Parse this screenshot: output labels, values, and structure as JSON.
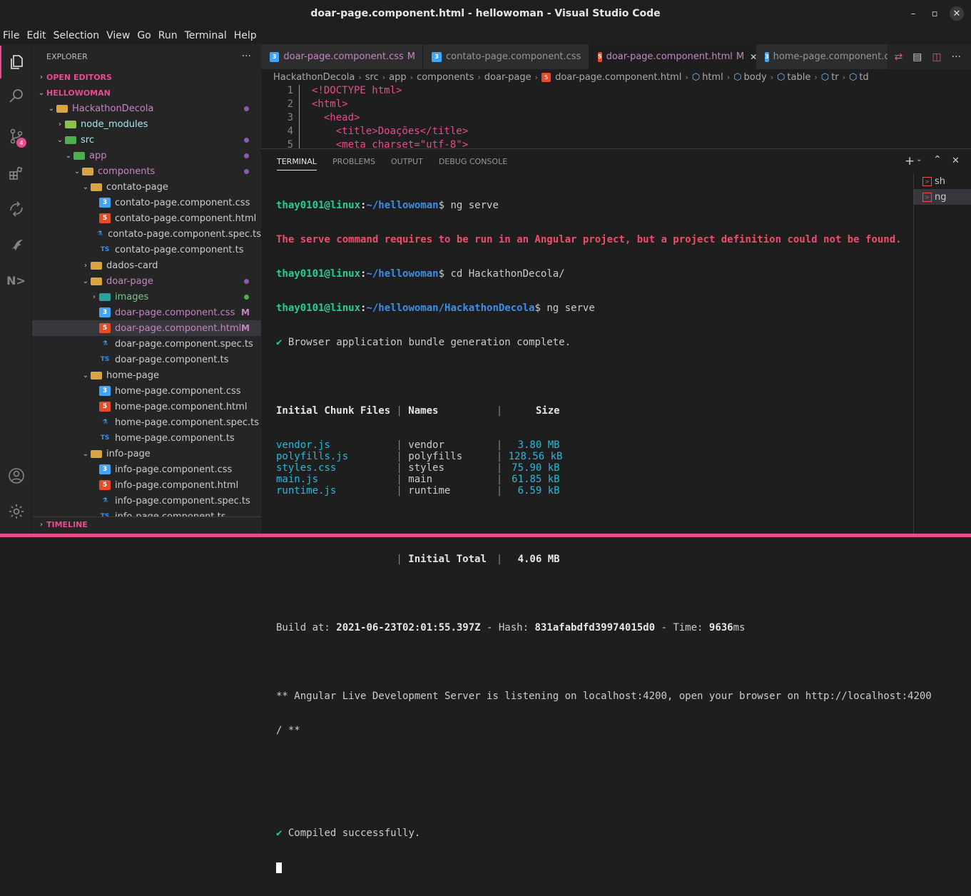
{
  "window": {
    "title": "doar-page.component.html - hellowoman - Visual Studio Code"
  },
  "menu": [
    "File",
    "Edit",
    "Selection",
    "View",
    "Go",
    "Run",
    "Terminal",
    "Help"
  ],
  "activity": {
    "scm_badge": "4"
  },
  "explorer": {
    "title": "EXPLORER",
    "open_editors": "OPEN EDITORS",
    "root": "HELLOWOMAN",
    "timeline": "TIMELINE",
    "tree": [
      {
        "label": "HackathonDecola",
        "depth": 1,
        "type": "folder",
        "open": true,
        "color": "#c586c0",
        "mark": "dot"
      },
      {
        "label": "node_modules",
        "depth": 2,
        "type": "node",
        "open": false,
        "color": "#a5e8f0",
        "mark": ""
      },
      {
        "label": "src",
        "depth": 2,
        "type": "src",
        "open": true,
        "color": "#a5e8f0",
        "mark": "dot"
      },
      {
        "label": "app",
        "depth": 3,
        "type": "app",
        "open": true,
        "color": "#c586c0",
        "mark": "dot"
      },
      {
        "label": "components",
        "depth": 4,
        "type": "folder",
        "open": true,
        "color": "#c586c0",
        "mark": "dot"
      },
      {
        "label": "contato-page",
        "depth": 5,
        "type": "folder",
        "open": true,
        "color": "#cccccc",
        "mark": ""
      },
      {
        "label": "contato-page.component.css",
        "depth": 6,
        "type": "css",
        "color": "#cccccc",
        "mark": ""
      },
      {
        "label": "contato-page.component.html",
        "depth": 6,
        "type": "html",
        "color": "#cccccc",
        "mark": ""
      },
      {
        "label": "contato-page.component.spec.ts",
        "depth": 6,
        "type": "spec",
        "color": "#cccccc",
        "mark": ""
      },
      {
        "label": "contato-page.component.ts",
        "depth": 6,
        "type": "ts",
        "color": "#cccccc",
        "mark": ""
      },
      {
        "label": "dados-card",
        "depth": 5,
        "type": "folder",
        "open": false,
        "color": "#cccccc",
        "mark": ""
      },
      {
        "label": "doar-page",
        "depth": 5,
        "type": "folder",
        "open": true,
        "color": "#c586c0",
        "mark": "dot"
      },
      {
        "label": "images",
        "depth": 6,
        "type": "images",
        "open": false,
        "color": "#73c991",
        "mark": "gdot"
      },
      {
        "label": "doar-page.component.css",
        "depth": 6,
        "type": "css",
        "color": "#c586c0",
        "mark": "M"
      },
      {
        "label": "doar-page.component.html",
        "depth": 6,
        "type": "html",
        "color": "#c586c0",
        "mark": "M",
        "selected": true
      },
      {
        "label": "doar-page.component.spec.ts",
        "depth": 6,
        "type": "spec",
        "color": "#cccccc",
        "mark": ""
      },
      {
        "label": "doar-page.component.ts",
        "depth": 6,
        "type": "ts",
        "color": "#cccccc",
        "mark": ""
      },
      {
        "label": "home-page",
        "depth": 5,
        "type": "folder",
        "open": true,
        "color": "#cccccc",
        "mark": ""
      },
      {
        "label": "home-page.component.css",
        "depth": 6,
        "type": "css",
        "color": "#cccccc",
        "mark": ""
      },
      {
        "label": "home-page.component.html",
        "depth": 6,
        "type": "html",
        "color": "#cccccc",
        "mark": ""
      },
      {
        "label": "home-page.component.spec.ts",
        "depth": 6,
        "type": "spec",
        "color": "#cccccc",
        "mark": ""
      },
      {
        "label": "home-page.component.ts",
        "depth": 6,
        "type": "ts",
        "color": "#cccccc",
        "mark": ""
      },
      {
        "label": "info-page",
        "depth": 5,
        "type": "folder",
        "open": true,
        "color": "#cccccc",
        "mark": ""
      },
      {
        "label": "info-page.component.css",
        "depth": 6,
        "type": "css",
        "color": "#cccccc",
        "mark": ""
      },
      {
        "label": "info-page.component.html",
        "depth": 6,
        "type": "html",
        "color": "#cccccc",
        "mark": ""
      },
      {
        "label": "info-page.component.spec.ts",
        "depth": 6,
        "type": "spec",
        "color": "#cccccc",
        "mark": ""
      },
      {
        "label": "info-page.component.ts",
        "depth": 6,
        "type": "ts",
        "color": "#cccccc",
        "mark": ""
      }
    ]
  },
  "tabs": [
    {
      "label": "doar-page.component.css",
      "type": "css",
      "status": "M",
      "active": false
    },
    {
      "label": "contato-page.component.css",
      "type": "css",
      "status": "",
      "active": false
    },
    {
      "label": "doar-page.component.html",
      "type": "html",
      "status": "M",
      "active": true
    },
    {
      "label": "home-page.component.cs",
      "type": "css",
      "status": "",
      "active": false
    }
  ],
  "breadcrumb": [
    "HackathonDecola",
    "src",
    "app",
    "components",
    "doar-page",
    "doar-page.component.html",
    "html",
    "body",
    "table",
    "tr",
    "td"
  ],
  "editor": {
    "lines": [
      {
        "n": "1",
        "text": "<!DOCTYPE html>"
      },
      {
        "n": "2",
        "text": "<html>"
      },
      {
        "n": "3",
        "text": "  <head>"
      },
      {
        "n": "4",
        "text": "    <title>Doações</title>"
      },
      {
        "n": "5",
        "text": "    <meta charset=\"utf-8\">"
      }
    ]
  },
  "panel": {
    "tabs": [
      "TERMINAL",
      "PROBLEMS",
      "OUTPUT",
      "DEBUG CONSOLE"
    ],
    "terminals": [
      "sh",
      "ng"
    ]
  },
  "terminal": {
    "prompt_user": "thay0101@linux",
    "path1": "~/hellowoman",
    "cmd1": "ng serve",
    "error": "The serve command requires to be run in an Angular project, but a project definition could not be found.",
    "cmd2": "cd HackathonDecola/",
    "path2": "~/hellowoman/HackathonDecola",
    "cmd3": "ng serve",
    "bundle_msg": "Browser application bundle generation complete.",
    "table_header": [
      "Initial Chunk Files",
      "Names",
      "Size"
    ],
    "table_rows": [
      [
        "vendor.js",
        "vendor",
        "3.80 MB"
      ],
      [
        "polyfills.js",
        "polyfills",
        "128.56 kB"
      ],
      [
        "styles.css",
        "styles",
        "75.90 kB"
      ],
      [
        "main.js",
        "main",
        "61.85 kB"
      ],
      [
        "runtime.js",
        "runtime",
        "6.59 kB"
      ]
    ],
    "total_label": "Initial Total",
    "total_value": "4.06 MB",
    "build_at_label": "Build at: ",
    "build_at": "2021-06-23T02:01:55.397Z",
    "hash_label": " - Hash: ",
    "hash": "831afabdfd39974015d0",
    "time_label": " - Time: ",
    "time": "9636",
    "time_unit": "ms",
    "server_line1": "** Angular Live Development Server is listening on localhost:4200, open your browser on http://localhost:4200",
    "server_line2": "/ **",
    "compiled": "Compiled successfully."
  },
  "colors": {
    "accent": "#e84c8e",
    "modified": "#c586c0"
  }
}
